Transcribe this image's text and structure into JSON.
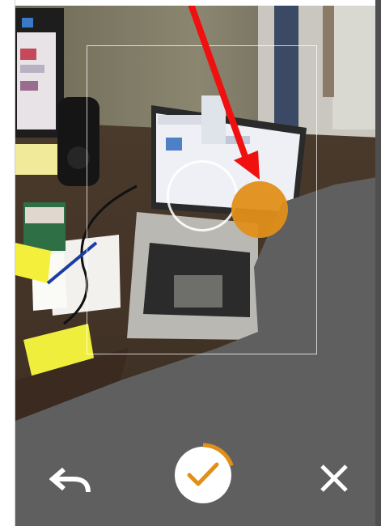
{
  "camera": {
    "mode": "document-capture",
    "icons": {
      "undo": "undo-icon",
      "confirm": "checkmark-icon",
      "close": "close-icon"
    },
    "colors": {
      "accent": "#e08f19",
      "arrow": "#f01010",
      "overlay": "#5f5f5f"
    },
    "capture_progress": 0.2
  }
}
